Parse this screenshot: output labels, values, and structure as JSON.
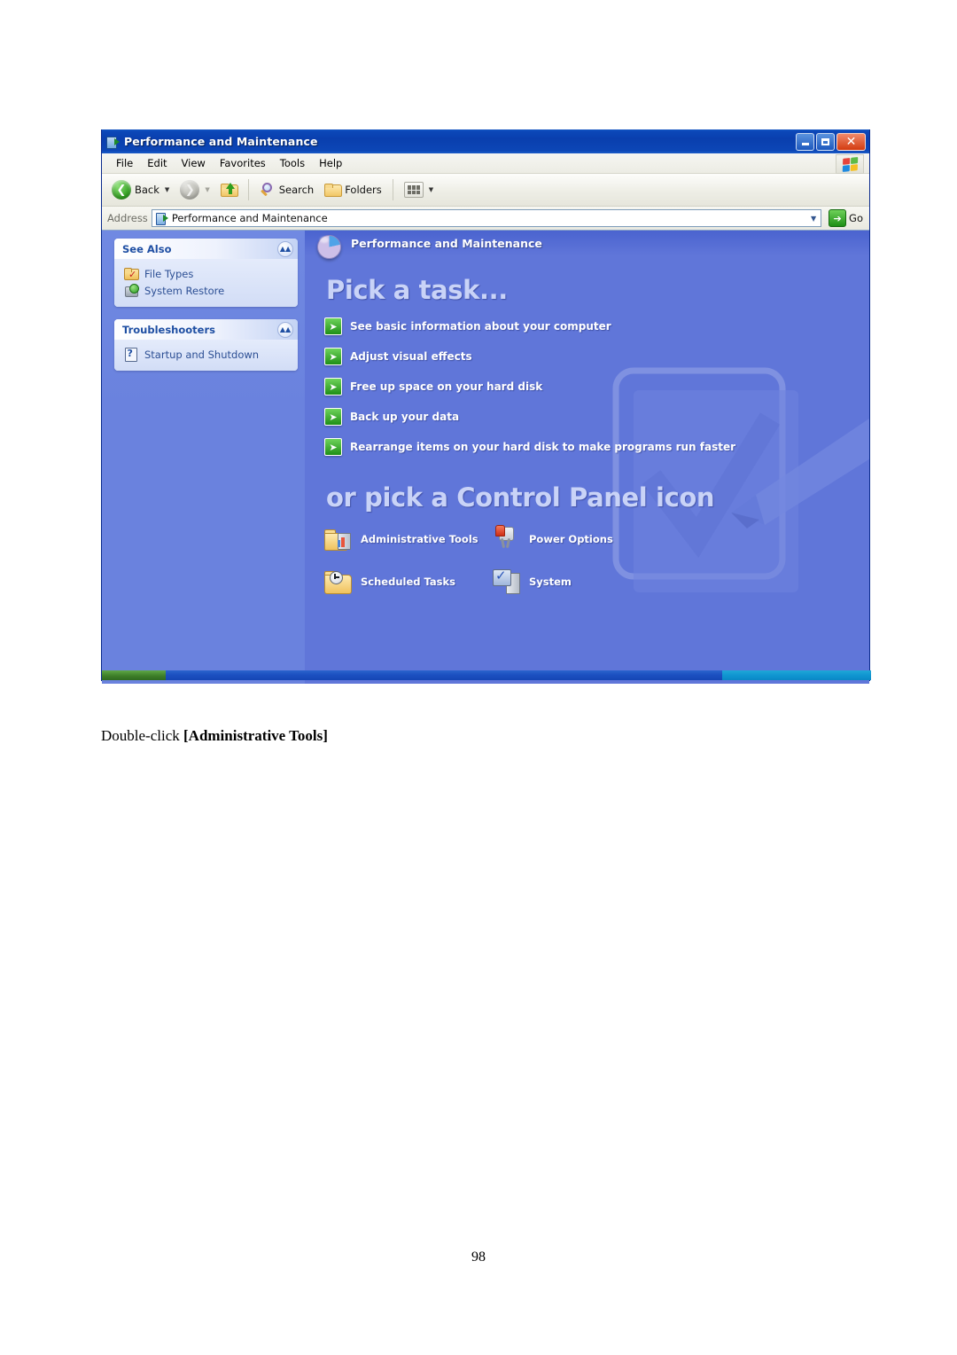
{
  "document": {
    "caption_prefix": "Double-click ",
    "caption_bold": "[Administrative Tools]",
    "page_number": "98"
  },
  "window": {
    "title": "Performance and Maintenance",
    "buttons": {
      "minimize": "_",
      "maximize": "❐",
      "close": "✕"
    },
    "menu": [
      {
        "label": "File"
      },
      {
        "label": "Edit"
      },
      {
        "label": "View"
      },
      {
        "label": "Favorites"
      },
      {
        "label": "Tools"
      },
      {
        "label": "Help"
      }
    ],
    "toolbar": {
      "back": "Back",
      "search": "Search",
      "folders": "Folders"
    },
    "address": {
      "label": "Address",
      "value": "Performance and Maintenance",
      "go": "Go"
    }
  },
  "sidebar": {
    "panels": [
      {
        "title": "See Also",
        "items": [
          {
            "label": "File Types",
            "icon": "file-types-icon"
          },
          {
            "label": "System Restore",
            "icon": "system-restore-icon"
          }
        ]
      },
      {
        "title": "Troubleshooters",
        "items": [
          {
            "label": "Startup and Shutdown",
            "icon": "help-question-icon"
          }
        ]
      }
    ]
  },
  "content": {
    "banner_title": "Performance and Maintenance",
    "pick_a_task_heading": "Pick a task...",
    "tasks": [
      {
        "label": "See basic information about your computer"
      },
      {
        "label": "Adjust visual effects"
      },
      {
        "label": "Free up space on your hard disk"
      },
      {
        "label": "Back up your data"
      },
      {
        "label": "Rearrange items on your hard disk to make programs run faster"
      }
    ],
    "control_panel_heading": "or pick a Control Panel icon",
    "control_panel_icons": [
      {
        "label": "Administrative Tools",
        "icon": "administrative-tools-icon"
      },
      {
        "label": "Power Options",
        "icon": "power-options-icon"
      },
      {
        "label": "Scheduled Tasks",
        "icon": "scheduled-tasks-icon"
      },
      {
        "label": "System",
        "icon": "system-icon"
      }
    ]
  },
  "colors": {
    "titlebar_blue": "#0a3fae",
    "content_blue": "#6076d9",
    "sidebar_blue": "#6a82de",
    "panel_header": "#1f4fa3",
    "heading_text": "#c9d3f7",
    "green_accent": "#1e8f16"
  }
}
